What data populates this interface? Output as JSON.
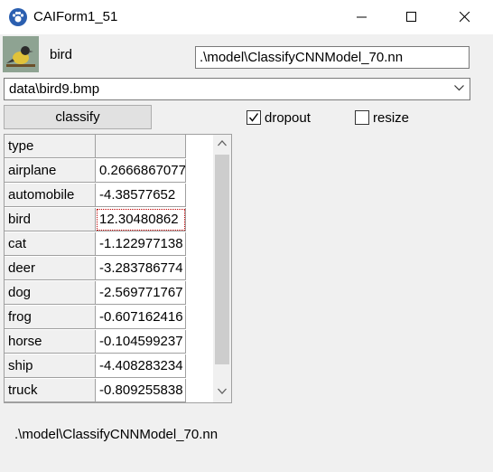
{
  "window": {
    "title": "CAIForm1_51",
    "icon": "paw-icon",
    "controls": [
      "minimize-icon",
      "maximize-icon",
      "close-icon"
    ]
  },
  "header": {
    "predicted_label": "bird",
    "model_path": ".\\model\\ClassifyCNNModel_70.nn"
  },
  "file_select": {
    "value": "data\\bird9.bmp"
  },
  "toolbar": {
    "classify_label": "classify",
    "dropout_label": "dropout",
    "dropout_checked": true,
    "resize_label": "resize",
    "resize_checked": false
  },
  "grid": {
    "header": [
      "type",
      ""
    ],
    "rows": [
      {
        "type": "airplane",
        "score": "0.2666867077"
      },
      {
        "type": "automobile",
        "score": "-4.38577652"
      },
      {
        "type": "bird",
        "score": "12.30480862"
      },
      {
        "type": "cat",
        "score": "-1.122977138"
      },
      {
        "type": "deer",
        "score": "-3.283786774"
      },
      {
        "type": "dog",
        "score": "-2.569771767"
      },
      {
        "type": "frog",
        "score": "-0.607162416"
      },
      {
        "type": "horse",
        "score": "-0.104599237"
      },
      {
        "type": "ship",
        "score": "-4.408283234"
      },
      {
        "type": "truck",
        "score": "-0.809255838"
      }
    ]
  },
  "status": {
    "text": ".\\model\\ClassifyCNNModel_70.nn"
  }
}
